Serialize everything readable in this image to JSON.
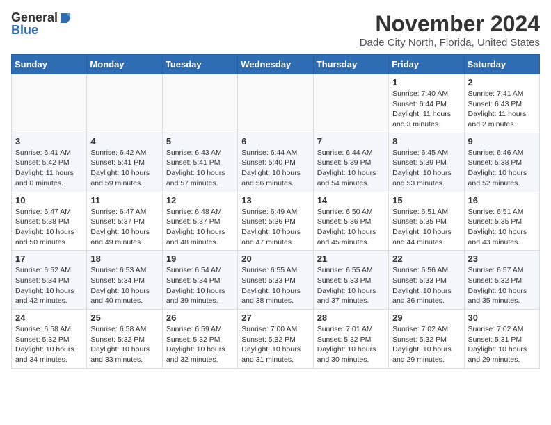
{
  "title": "November 2024",
  "subtitle": "Dade City North, Florida, United States",
  "logo": {
    "general": "General",
    "blue": "Blue"
  },
  "days_of_week": [
    "Sunday",
    "Monday",
    "Tuesday",
    "Wednesday",
    "Thursday",
    "Friday",
    "Saturday"
  ],
  "weeks": [
    [
      {
        "day": "",
        "info": ""
      },
      {
        "day": "",
        "info": ""
      },
      {
        "day": "",
        "info": ""
      },
      {
        "day": "",
        "info": ""
      },
      {
        "day": "",
        "info": ""
      },
      {
        "day": "1",
        "info": "Sunrise: 7:40 AM\nSunset: 6:44 PM\nDaylight: 11 hours and 3 minutes."
      },
      {
        "day": "2",
        "info": "Sunrise: 7:41 AM\nSunset: 6:43 PM\nDaylight: 11 hours and 2 minutes."
      }
    ],
    [
      {
        "day": "3",
        "info": "Sunrise: 6:41 AM\nSunset: 5:42 PM\nDaylight: 11 hours and 0 minutes."
      },
      {
        "day": "4",
        "info": "Sunrise: 6:42 AM\nSunset: 5:41 PM\nDaylight: 10 hours and 59 minutes."
      },
      {
        "day": "5",
        "info": "Sunrise: 6:43 AM\nSunset: 5:41 PM\nDaylight: 10 hours and 57 minutes."
      },
      {
        "day": "6",
        "info": "Sunrise: 6:44 AM\nSunset: 5:40 PM\nDaylight: 10 hours and 56 minutes."
      },
      {
        "day": "7",
        "info": "Sunrise: 6:44 AM\nSunset: 5:39 PM\nDaylight: 10 hours and 54 minutes."
      },
      {
        "day": "8",
        "info": "Sunrise: 6:45 AM\nSunset: 5:39 PM\nDaylight: 10 hours and 53 minutes."
      },
      {
        "day": "9",
        "info": "Sunrise: 6:46 AM\nSunset: 5:38 PM\nDaylight: 10 hours and 52 minutes."
      }
    ],
    [
      {
        "day": "10",
        "info": "Sunrise: 6:47 AM\nSunset: 5:38 PM\nDaylight: 10 hours and 50 minutes."
      },
      {
        "day": "11",
        "info": "Sunrise: 6:47 AM\nSunset: 5:37 PM\nDaylight: 10 hours and 49 minutes."
      },
      {
        "day": "12",
        "info": "Sunrise: 6:48 AM\nSunset: 5:37 PM\nDaylight: 10 hours and 48 minutes."
      },
      {
        "day": "13",
        "info": "Sunrise: 6:49 AM\nSunset: 5:36 PM\nDaylight: 10 hours and 47 minutes."
      },
      {
        "day": "14",
        "info": "Sunrise: 6:50 AM\nSunset: 5:36 PM\nDaylight: 10 hours and 45 minutes."
      },
      {
        "day": "15",
        "info": "Sunrise: 6:51 AM\nSunset: 5:35 PM\nDaylight: 10 hours and 44 minutes."
      },
      {
        "day": "16",
        "info": "Sunrise: 6:51 AM\nSunset: 5:35 PM\nDaylight: 10 hours and 43 minutes."
      }
    ],
    [
      {
        "day": "17",
        "info": "Sunrise: 6:52 AM\nSunset: 5:34 PM\nDaylight: 10 hours and 42 minutes."
      },
      {
        "day": "18",
        "info": "Sunrise: 6:53 AM\nSunset: 5:34 PM\nDaylight: 10 hours and 40 minutes."
      },
      {
        "day": "19",
        "info": "Sunrise: 6:54 AM\nSunset: 5:34 PM\nDaylight: 10 hours and 39 minutes."
      },
      {
        "day": "20",
        "info": "Sunrise: 6:55 AM\nSunset: 5:33 PM\nDaylight: 10 hours and 38 minutes."
      },
      {
        "day": "21",
        "info": "Sunrise: 6:55 AM\nSunset: 5:33 PM\nDaylight: 10 hours and 37 minutes."
      },
      {
        "day": "22",
        "info": "Sunrise: 6:56 AM\nSunset: 5:33 PM\nDaylight: 10 hours and 36 minutes."
      },
      {
        "day": "23",
        "info": "Sunrise: 6:57 AM\nSunset: 5:32 PM\nDaylight: 10 hours and 35 minutes."
      }
    ],
    [
      {
        "day": "24",
        "info": "Sunrise: 6:58 AM\nSunset: 5:32 PM\nDaylight: 10 hours and 34 minutes."
      },
      {
        "day": "25",
        "info": "Sunrise: 6:58 AM\nSunset: 5:32 PM\nDaylight: 10 hours and 33 minutes."
      },
      {
        "day": "26",
        "info": "Sunrise: 6:59 AM\nSunset: 5:32 PM\nDaylight: 10 hours and 32 minutes."
      },
      {
        "day": "27",
        "info": "Sunrise: 7:00 AM\nSunset: 5:32 PM\nDaylight: 10 hours and 31 minutes."
      },
      {
        "day": "28",
        "info": "Sunrise: 7:01 AM\nSunset: 5:32 PM\nDaylight: 10 hours and 30 minutes."
      },
      {
        "day": "29",
        "info": "Sunrise: 7:02 AM\nSunset: 5:32 PM\nDaylight: 10 hours and 29 minutes."
      },
      {
        "day": "30",
        "info": "Sunrise: 7:02 AM\nSunset: 5:31 PM\nDaylight: 10 hours and 29 minutes."
      }
    ]
  ]
}
